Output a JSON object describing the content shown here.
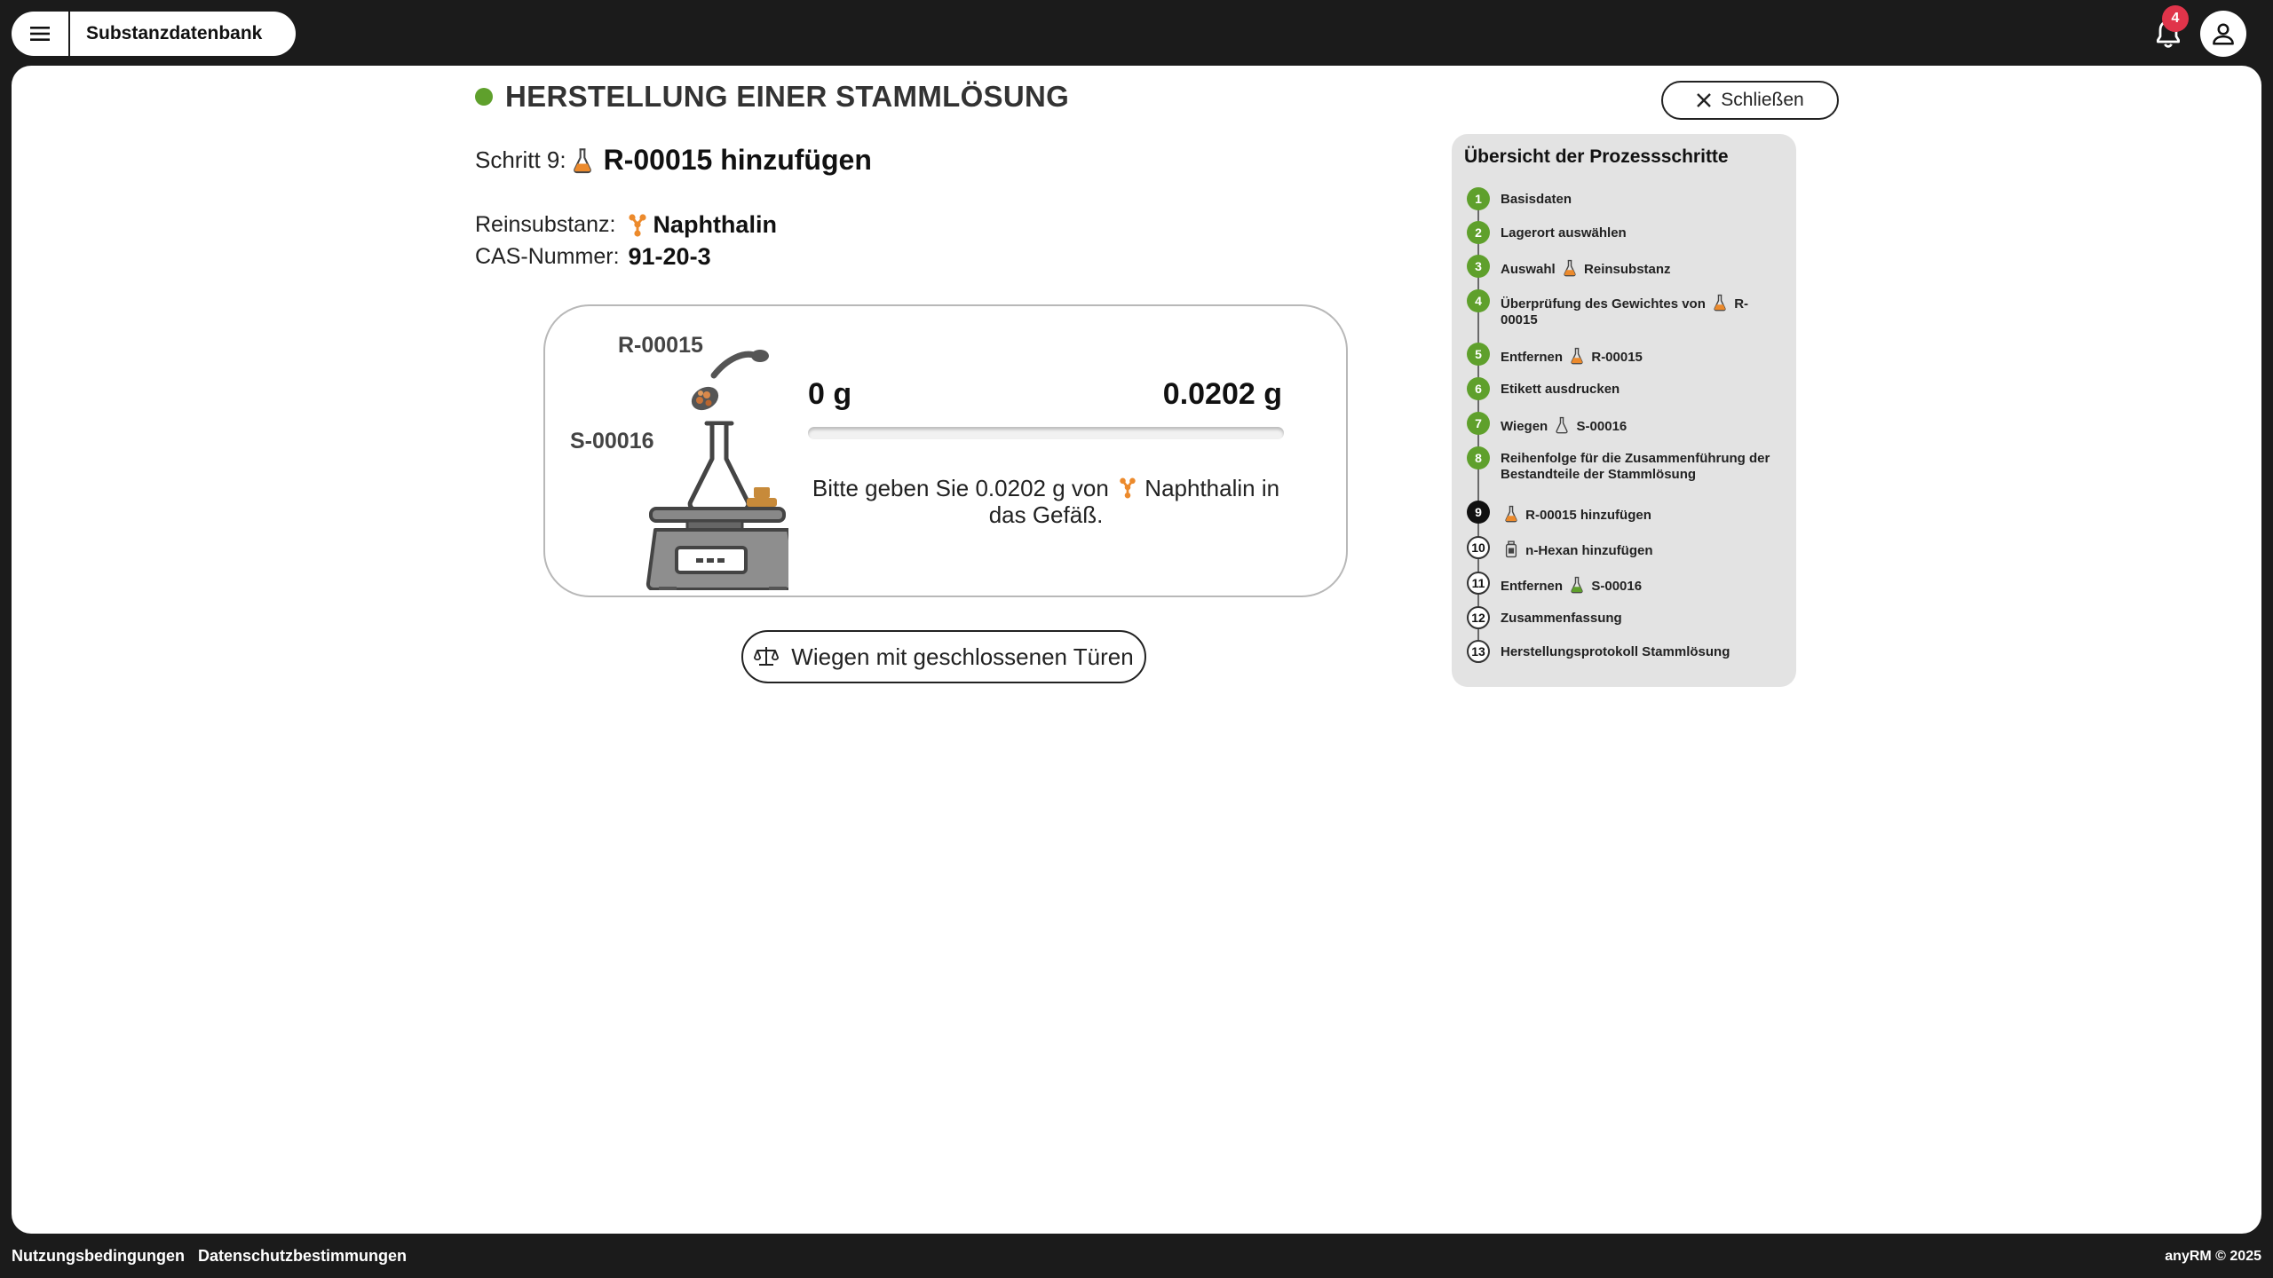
{
  "topbar": {
    "app_name": "Substanzdatenbank",
    "notification_count": "4"
  },
  "process": {
    "title": "HERSTELLUNG EINER STAMMLÖSUNG",
    "status_color": "#5fa02c",
    "close_label": "Schließen"
  },
  "step": {
    "prefix": "Schritt 9:",
    "name": "R-00015 hinzufügen",
    "icon": "flask-orange-icon"
  },
  "substance": {
    "label": "Reinsubstanz:",
    "name": "Naphthalin",
    "icon": "molecule-orange-icon",
    "cas_label": "CAS-Nummer:",
    "cas_value": "91-20-3"
  },
  "scale": {
    "source_label": "R-00015",
    "target_label": "S-00016",
    "current_weight": "0 g",
    "target_weight": "0.0202 g",
    "progress_fraction": 0,
    "instruction_before": "Bitte geben Sie 0.0202 g von",
    "instruction_substance": "Naphthalin",
    "instruction_after": "in das Gefäß."
  },
  "weigh_button": {
    "label": "Wiegen mit geschlossenen Türen",
    "icon": "balance-scale-icon"
  },
  "overview": {
    "title": "Übersicht der Prozessschritte",
    "steps": [
      {
        "num": "1",
        "state": "done",
        "label": "Basisdaten"
      },
      {
        "num": "2",
        "state": "done",
        "label": "Lagerort auswählen"
      },
      {
        "num": "3",
        "state": "done",
        "label_a": "Auswahl",
        "icon": "flask-orange-icon",
        "label_b": "Reinsubstanz"
      },
      {
        "num": "4",
        "state": "done",
        "label_a": "Überprüfung des Gewichtes von",
        "icon": "flask-orange-icon",
        "label_b": "R-00015"
      },
      {
        "num": "5",
        "state": "done",
        "label_a": "Entfernen",
        "icon": "flask-orange-icon",
        "label_b": "R-00015"
      },
      {
        "num": "6",
        "state": "done",
        "label": "Etikett ausdrucken"
      },
      {
        "num": "7",
        "state": "done",
        "label_a": "Wiegen",
        "icon": "flask-outline-icon",
        "label_b": "S-00016"
      },
      {
        "num": "8",
        "state": "done",
        "label": "Reihenfolge für die Zusammenführung der Bestandteile der Stammlösung"
      },
      {
        "num": "9",
        "state": "current",
        "icon": "flask-orange-icon",
        "label_b": "R-00015 hinzufügen"
      },
      {
        "num": "10",
        "state": "todo",
        "icon": "bottle-icon",
        "label_b": "n-Hexan hinzufügen"
      },
      {
        "num": "11",
        "state": "todo",
        "label_a": "Entfernen",
        "icon": "flask-green-icon",
        "label_b": "S-00016"
      },
      {
        "num": "12",
        "state": "todo",
        "label": "Zusammenfassung"
      },
      {
        "num": "13",
        "state": "todo",
        "label": "Herstellungsprotokoll Stammlösung"
      }
    ]
  },
  "footer": {
    "terms": "Nutzungsbedingungen",
    "privacy": "Datenschutzbestimmungen",
    "copyright": "anyRM © 2025"
  },
  "colors": {
    "accent_green": "#5fa02c",
    "substance_orange": "#ec8a2c",
    "badge_red": "#e0344a",
    "frame_dark": "#1b1b1b"
  }
}
